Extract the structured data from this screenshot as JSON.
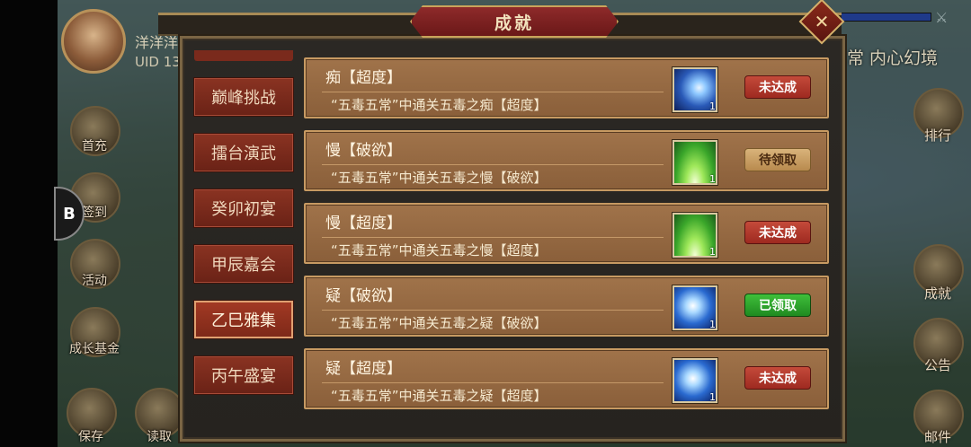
{
  "player": {
    "name": "洋洋洋",
    "uid": "UID 13"
  },
  "top_right": {
    "title": "常 内心幻境"
  },
  "left_menu": [
    {
      "label": "首充",
      "icon": "first-charge-icon"
    },
    {
      "label": "签到",
      "icon": "checkin-icon"
    },
    {
      "label": "活动",
      "icon": "activity-icon"
    },
    {
      "label": "成长基金",
      "icon": "growth-fund-icon"
    },
    {
      "label": "保存",
      "icon": "save-icon"
    },
    {
      "label": "读取",
      "icon": "load-icon"
    }
  ],
  "right_menu": [
    {
      "label": "排行",
      "icon": "ranking-icon"
    },
    {
      "label": "成就",
      "icon": "achievement-icon"
    },
    {
      "label": "公告",
      "icon": "announcement-icon"
    },
    {
      "label": "邮件",
      "icon": "mail-icon"
    }
  ],
  "panel": {
    "title": "成就",
    "close": "✕"
  },
  "tabs": [
    {
      "label": "巅峰挑战"
    },
    {
      "label": "擂台演武"
    },
    {
      "label": "癸卯初宴"
    },
    {
      "label": "甲辰嘉会"
    },
    {
      "label": "乙巳雅集"
    },
    {
      "label": "丙午盛宴"
    }
  ],
  "achievements": [
    {
      "title": "痴【超度】",
      "desc": "“五毒五常”中通关五毒之痴【超度】",
      "icon": "moon-icon",
      "count": "1",
      "status": "未达成",
      "status_type": "red"
    },
    {
      "title": "慢【破欲】",
      "desc": "“五毒五常”中通关五毒之慢【破欲】",
      "icon": "green-light-icon",
      "count": "1",
      "status": "待领取",
      "status_type": "gold"
    },
    {
      "title": "慢【超度】",
      "desc": "“五毒五常”中通关五毒之慢【超度】",
      "icon": "green-light-icon",
      "count": "1",
      "status": "未达成",
      "status_type": "red"
    },
    {
      "title": "疑【破欲】",
      "desc": "“五毒五常”中通关五毒之疑【破欲】",
      "icon": "lightning-icon",
      "count": "1",
      "status": "已领取",
      "status_type": "green"
    },
    {
      "title": "疑【超度】",
      "desc": "“五毒五常”中通关五毒之疑【超度】",
      "icon": "lightning-icon",
      "count": "1",
      "status": "未达成",
      "status_type": "red"
    }
  ],
  "float_button": {
    "label": "B"
  }
}
